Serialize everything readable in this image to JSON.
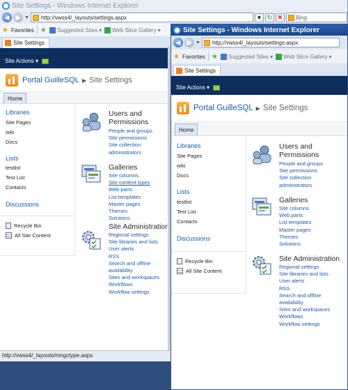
{
  "back_window": {
    "title": "Site Settings - Windows Internet Explorer",
    "address": "http://vwss4/_layouts/settings.aspx",
    "search_placeholder": "Bing",
    "favorites_label": "Favorites",
    "suggested_sites": "Suggested Sites",
    "web_slice_gallery": "Web Slice Gallery",
    "tab_title": "Site Settings",
    "site_actions": "Site Actions",
    "site_name": "Portal GuilleSQL",
    "page_name": "Site Settings",
    "home_tab": "Home",
    "status_url": "http://vwss4/_layouts/mngctype.aspx"
  },
  "front_window": {
    "title": "Site Settings - Windows Internet Explorer",
    "address": "http://vwss4/_layouts/settings.aspx",
    "favorites_label": "Favorites",
    "suggested_sites": "Suggested Sites",
    "web_slice_gallery": "Web Slice Gallery",
    "tab_title": "Site Settings",
    "site_actions": "Site Actions",
    "site_name": "Portal GuilleSQL",
    "page_name": "Site Settings",
    "home_tab": "Home"
  },
  "quick_launch": {
    "libraries": "Libraries",
    "site_pages": "Site Pages",
    "wiki": "wiki",
    "docs": "Docs",
    "lists": "Lists",
    "testlist": "testlist",
    "test_list": "Test List",
    "contacts": "Contacts",
    "discussions": "Discussions",
    "recycle_bin": "Recycle Bin",
    "all_site_content": "All Site Content"
  },
  "users_and_permissions": {
    "title_line1": "Users and",
    "title_line2": "Permissions",
    "links": [
      "People and groups",
      "Site permissions",
      "Site collection",
      "administrators"
    ]
  },
  "galleries": {
    "title": "Galleries",
    "links_back": [
      "Site columns",
      "Site content types",
      "Web parts",
      "List templates",
      "Master pages",
      "Themes",
      "Solutions"
    ],
    "links_front": [
      "Site columns",
      "Web parts",
      "List templates",
      "Master pages",
      "Themes",
      "Solutions"
    ]
  },
  "site_administration": {
    "title": "Site Administration",
    "links": [
      "Regional settings",
      "Site libraries and lists",
      "User alerts",
      "RSS",
      "Search and offline",
      "availability",
      "Sites and workspaces",
      "Workflows",
      "Workflow settings"
    ]
  },
  "colors": {
    "link": "#1c5aa0",
    "ribbon": "#0e2e5e",
    "title_active": "#1c4586"
  }
}
